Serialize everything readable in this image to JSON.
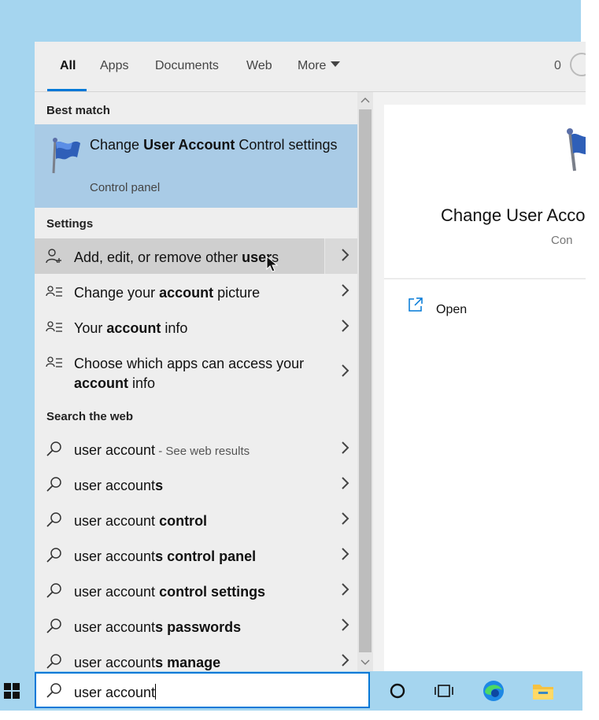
{
  "tabs": {
    "all": "All",
    "apps": "Apps",
    "documents": "Documents",
    "web": "Web",
    "more": "More",
    "count": "0"
  },
  "best_match": {
    "header": "Best match",
    "title_pre": "Change ",
    "title_bold": "User Account",
    "title_post": " Control settings",
    "subtitle": "Control panel"
  },
  "settings": {
    "header": "Settings",
    "items": [
      {
        "pre": "Add, edit, or remove other ",
        "bold": "user",
        "post": "s"
      },
      {
        "pre": "Change your ",
        "bold": "account",
        "post": " picture"
      },
      {
        "pre": "Your ",
        "bold": "account",
        "post": " info"
      },
      {
        "pre": "Choose which apps can access your ",
        "bold": "account",
        "post": " info"
      }
    ]
  },
  "web": {
    "header": "Search the web",
    "items": [
      {
        "pre": "user account",
        "bold": "",
        "hint": " - See web results"
      },
      {
        "pre": "user account",
        "bold": "s",
        "hint": ""
      },
      {
        "pre": "user account ",
        "bold": "control",
        "hint": ""
      },
      {
        "pre": "user account",
        "bold": "s control panel",
        "hint": ""
      },
      {
        "pre": "user account ",
        "bold": "control settings",
        "hint": ""
      },
      {
        "pre": "user account",
        "bold": "s passwords",
        "hint": ""
      },
      {
        "pre": "user account",
        "bold": "s manage",
        "hint": ""
      }
    ]
  },
  "preview": {
    "title": "Change User Acco",
    "subtitle": "Con",
    "open_label": "Open"
  },
  "search": {
    "value": "user account"
  },
  "colors": {
    "accent": "#0078d7",
    "selected_bg": "#a9cbe6",
    "desktop": "#a5d5ef"
  },
  "icons": [
    "windows-start-icon",
    "cortana-circle-icon",
    "task-view-icon",
    "edge-icon",
    "file-explorer-icon",
    "uac-flag-icon",
    "person-add-icon",
    "person-list-icon",
    "search-icon",
    "chevron-right-icon",
    "open-external-icon"
  ]
}
